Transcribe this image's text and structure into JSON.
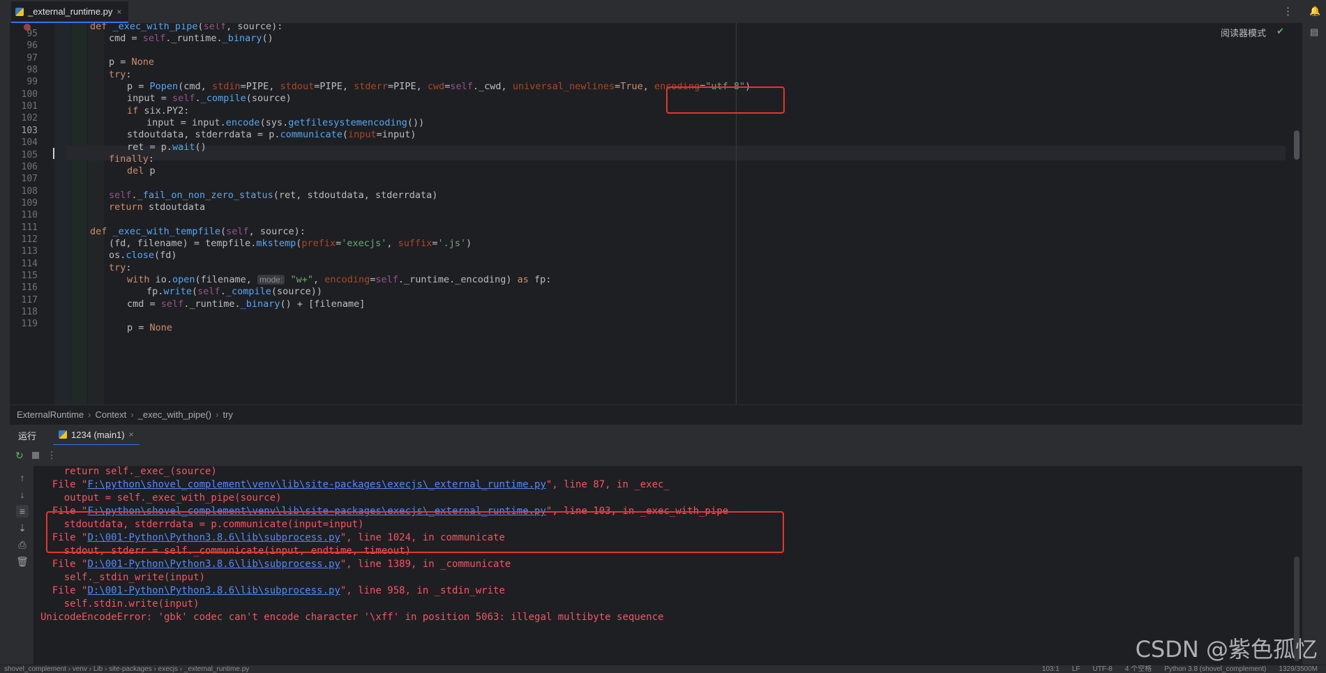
{
  "tab": {
    "filename": "_external_runtime.py",
    "close": "×"
  },
  "editor": {
    "reader_mode": "阅读器模式",
    "check": "✔",
    "more": "⋮",
    "line_numbers": [
      "95",
      "96",
      "97",
      "98",
      "99",
      "100",
      "101",
      "102",
      "103",
      "104",
      "105",
      "106",
      "107",
      "108",
      "109",
      "110",
      "111",
      "112",
      "113",
      "114",
      "115",
      "116",
      "117",
      "118",
      "119"
    ]
  },
  "breadcrumbs": [
    "ExternalRuntime",
    "Context",
    "_exec_with_pipe()",
    "try"
  ],
  "breadcrumb_sep": "›",
  "run": {
    "label": "运行",
    "tab_label": "1234 (main1)",
    "tab_close": "×"
  },
  "console": {
    "l1": "    return self._exec_(source)",
    "l2a": "  File \"",
    "l2link": "F:\\python\\shovel_complement\\venv\\lib\\site-packages\\execjs\\_external_runtime.py",
    "l2b": "\", line 87, in _exec_",
    "l3": "    output = self._exec_with_pipe(source)",
    "l4a": "  File \"",
    "l4link": "F:\\python\\shovel_complement\\venv\\lib\\site-packages\\execjs\\_external_runtime.py",
    "l4b": "\", line 103, in _exec_with_pipe",
    "l5": "    stdoutdata, stderrdata = p.communicate(input=input)",
    "l6a": "  File \"",
    "l6link": "D:\\001-Python\\Python3.8.6\\lib\\subprocess.py",
    "l6b": "\", line 1024, in communicate",
    "l7": "    stdout, stderr = self._communicate(input, endtime, timeout)",
    "l8a": "  File \"",
    "l8link": "D:\\001-Python\\Python3.8.6\\lib\\subprocess.py",
    "l8b": "\", line 1389, in _communicate",
    "l9": "    self._stdin_write(input)",
    "l10a": "  File \"",
    "l10link": "D:\\001-Python\\Python3.8.6\\lib\\subprocess.py",
    "l10b": "\", line 958, in _stdin_write",
    "l11": "    self.stdin.write(input)",
    "l12": "UnicodeEncodeError: 'gbk' codec can't encode character '\\xff' in position 5063: illegal multibyte sequence"
  },
  "status": {
    "path": "shovel_complement  ›  venv  ›  Lib  ›  site-packages  ›  execjs  ›  _external_runtime.py",
    "position": "103:1",
    "line_sep": "LF",
    "encoding": "UTF-8",
    "indent": "4 个空格",
    "interpreter": "Python 3.8 (shovel_complement)",
    "memory": "1329/3500M"
  },
  "watermark": "CSDN @紫色孤忆"
}
